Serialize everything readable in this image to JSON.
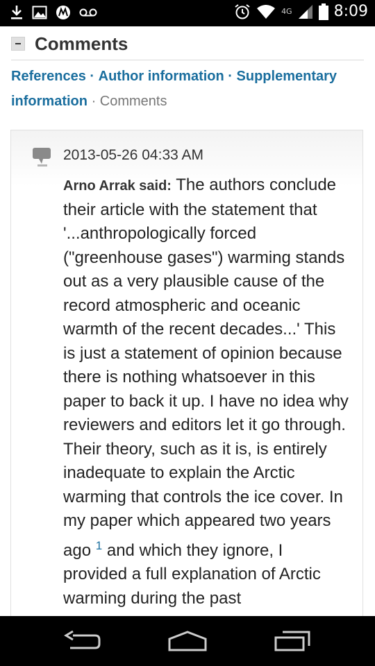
{
  "status_bar": {
    "time": "8:09",
    "network": "4G",
    "icons": [
      "download-icon",
      "image-icon",
      "motorola-icon",
      "voicemail-icon",
      "alarm-icon",
      "wifi-icon",
      "signal-icon",
      "battery-icon"
    ]
  },
  "section": {
    "title": "Comments",
    "collapse_symbol": "-"
  },
  "nav": {
    "links": [
      "References",
      "Author information",
      "Supplementary information"
    ],
    "separator": "·",
    "current": "Comments"
  },
  "comment": {
    "date": "2013-05-26 04:33 AM",
    "author": "Arno Arrak said:",
    "text_part1": "The authors conclude their article with the statement that '...anthropologically forced (\"greenhouse gases\") warming stands out as a very plausible cause of the record atmospheric and oceanic warmth of the recent decades...' This is just a statement of opinion because there is nothing whatsoever in this paper to back it up. I have no idea why reviewers and editors let it go through. Their theory, such as it is, is entirely inadequate to explain the Arctic warming that controls the ice cover. In my paper which appeared two years ago",
    "ref": "1",
    "text_part2": "and which they ignore, I provided a full explanation of Arctic warming during the past"
  },
  "colors": {
    "link": "#1a6e9e",
    "status_bar_bg": "#000000",
    "text": "#222222"
  },
  "navigation_bar": {
    "buttons": [
      "back-icon",
      "home-icon",
      "recents-icon"
    ]
  }
}
